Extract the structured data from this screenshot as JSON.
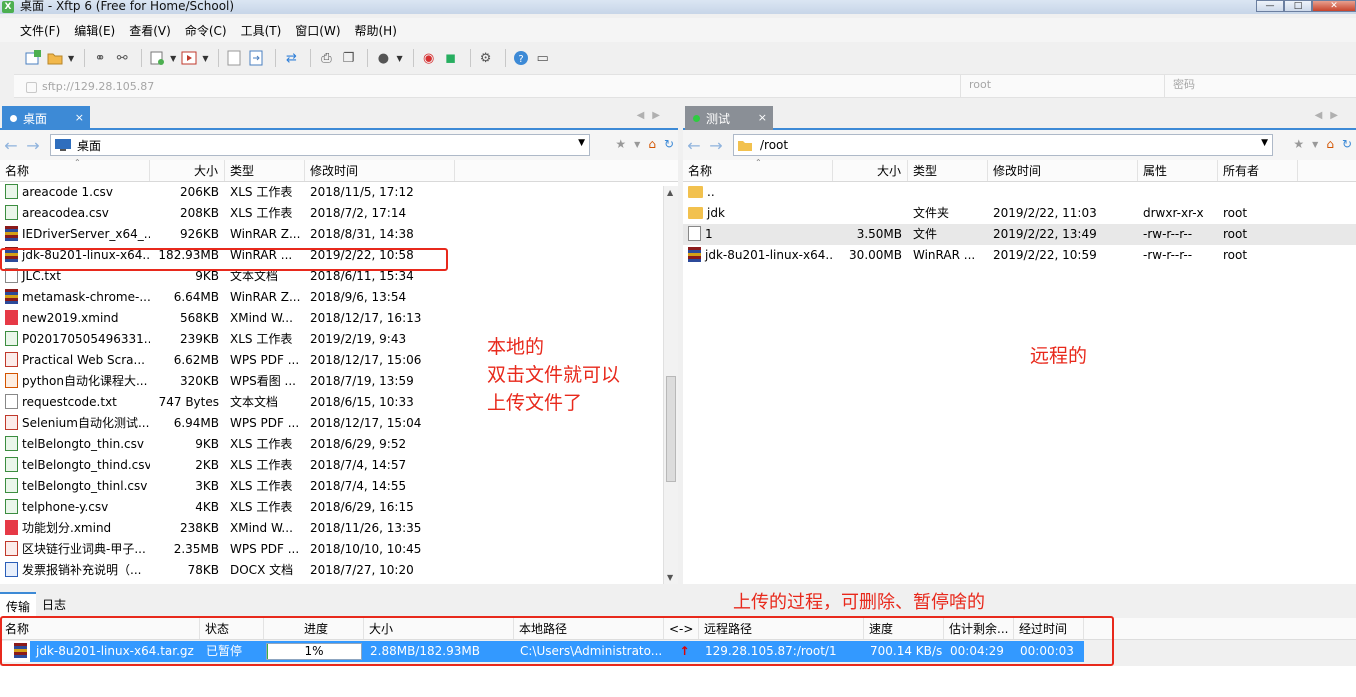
{
  "window": {
    "title": "桌面 - Xftp 6 (Free for Home/School)",
    "controls": [
      "—",
      "□",
      "✕"
    ]
  },
  "menu": [
    "文件(F)",
    "编辑(E)",
    "查看(V)",
    "命令(C)",
    "工具(T)",
    "窗口(W)",
    "帮助(H)"
  ],
  "address": {
    "host_placeholder": "sftp://129.28.105.87",
    "user_placeholder": "root",
    "password_placeholder": "密码"
  },
  "left_pane": {
    "tab_label": "桌面",
    "tab_close": "×",
    "path": "桌面",
    "columns": [
      "名称",
      "大小",
      "类型",
      "修改时间"
    ],
    "files": [
      {
        "name": "areacode 1.csv",
        "size": "206KB",
        "type": "XLS 工作表",
        "modified": "2018/11/5, 17:12",
        "icon": "xls"
      },
      {
        "name": "areacodea.csv",
        "size": "208KB",
        "type": "XLS 工作表",
        "modified": "2018/7/2, 17:14",
        "icon": "xls"
      },
      {
        "name": "IEDriverServer_x64_...",
        "size": "926KB",
        "type": "WinRAR Z...",
        "modified": "2018/8/31, 14:38",
        "icon": "rar"
      },
      {
        "name": "jdk-8u201-linux-x64....",
        "size": "182.93MB",
        "type": "WinRAR ...",
        "modified": "2019/2/22, 10:58",
        "icon": "rar"
      },
      {
        "name": "JLC.txt",
        "size": "9KB",
        "type": "文本文档",
        "modified": "2018/6/11, 15:34",
        "icon": "txt"
      },
      {
        "name": "metamask-chrome-...",
        "size": "6.64MB",
        "type": "WinRAR Z...",
        "modified": "2018/9/6, 13:54",
        "icon": "rar"
      },
      {
        "name": "new2019.xmind",
        "size": "568KB",
        "type": "XMind W...",
        "modified": "2018/12/17, 16:13",
        "icon": "xmind"
      },
      {
        "name": "P020170505496331...",
        "size": "239KB",
        "type": "XLS 工作表",
        "modified": "2019/2/19, 9:43",
        "icon": "xls"
      },
      {
        "name": "Practical Web Scra...",
        "size": "6.62MB",
        "type": "WPS PDF ...",
        "modified": "2018/12/17, 15:06",
        "icon": "pdf"
      },
      {
        "name": "python自动化课程大...",
        "size": "320KB",
        "type": "WPS看图 ...",
        "modified": "2018/7/19, 13:59",
        "icon": "img"
      },
      {
        "name": "requestcode.txt",
        "size": "747 Bytes",
        "type": "文本文档",
        "modified": "2018/6/15, 10:33",
        "icon": "txt"
      },
      {
        "name": "Selenium自动化测试...",
        "size": "6.94MB",
        "type": "WPS PDF ...",
        "modified": "2018/12/17, 15:04",
        "icon": "pdf"
      },
      {
        "name": "telBelongto_thin.csv",
        "size": "9KB",
        "type": "XLS 工作表",
        "modified": "2018/6/29, 9:52",
        "icon": "xls"
      },
      {
        "name": "telBelongto_thind.csv",
        "size": "2KB",
        "type": "XLS 工作表",
        "modified": "2018/7/4, 14:57",
        "icon": "xls"
      },
      {
        "name": "telBelongto_thinl.csv",
        "size": "3KB",
        "type": "XLS 工作表",
        "modified": "2018/7/4, 14:55",
        "icon": "xls"
      },
      {
        "name": "telphone-y.csv",
        "size": "4KB",
        "type": "XLS 工作表",
        "modified": "2018/6/29, 16:15",
        "icon": "xls"
      },
      {
        "name": "功能划分.xmind",
        "size": "238KB",
        "type": "XMind W...",
        "modified": "2018/11/26, 13:35",
        "icon": "xmind"
      },
      {
        "name": "区块链行业词典-甲子...",
        "size": "2.35MB",
        "type": "WPS PDF ...",
        "modified": "2018/10/10, 10:45",
        "icon": "pdf"
      },
      {
        "name": "发票报销补充说明（...",
        "size": "78KB",
        "type": "DOCX 文档",
        "modified": "2018/7/27, 10:20",
        "icon": "doc"
      }
    ]
  },
  "right_pane": {
    "tab_label": "测试",
    "tab_close": "×",
    "path": "/root",
    "columns": [
      "名称",
      "大小",
      "类型",
      "修改时间",
      "属性",
      "所有者"
    ],
    "files": [
      {
        "name": "..",
        "size": "",
        "type": "",
        "modified": "",
        "perm": "",
        "owner": "",
        "icon": "folder"
      },
      {
        "name": "jdk",
        "size": "",
        "type": "文件夹",
        "modified": "2019/2/22, 11:03",
        "perm": "drwxr-xr-x",
        "owner": "root",
        "icon": "folder"
      },
      {
        "name": "1",
        "size": "3.50MB",
        "type": "文件",
        "modified": "2019/2/22, 13:49",
        "perm": "-rw-r--r--",
        "owner": "root",
        "icon": "txt"
      },
      {
        "name": "jdk-8u201-linux-x64....",
        "size": "30.00MB",
        "type": "WinRAR ...",
        "modified": "2019/2/22, 10:59",
        "perm": "-rw-r--r--",
        "owner": "root",
        "icon": "rar"
      }
    ]
  },
  "annotations": {
    "local": [
      "本地的",
      "双击文件就可以",
      "上传文件了"
    ],
    "remote": "远程的",
    "transfer": "上传的过程，可删除、暂停啥的"
  },
  "bottom_tabs": [
    "传输",
    "日志"
  ],
  "transfer": {
    "columns": [
      "名称",
      "状态",
      "进度",
      "大小",
      "本地路径",
      "<->",
      "远程路径",
      "速度",
      "估计剩余...",
      "经过时间"
    ],
    "row": {
      "name": "jdk-8u201-linux-x64.tar.gz",
      "status": "已暂停",
      "progress": "1%",
      "progress_fraction": 0.01,
      "size": "2.88MB/182.93MB",
      "local_path": "C:\\Users\\Administrato...",
      "direction": "↑",
      "remote_path": "129.28.105.87:/root/1",
      "speed": "700.14 KB/s",
      "remaining": "00:04:29",
      "elapsed": "00:00:03"
    }
  },
  "colors": {
    "accent": "#3d8ad6",
    "selection": "#3399ff",
    "annotation": "#e8291c"
  }
}
